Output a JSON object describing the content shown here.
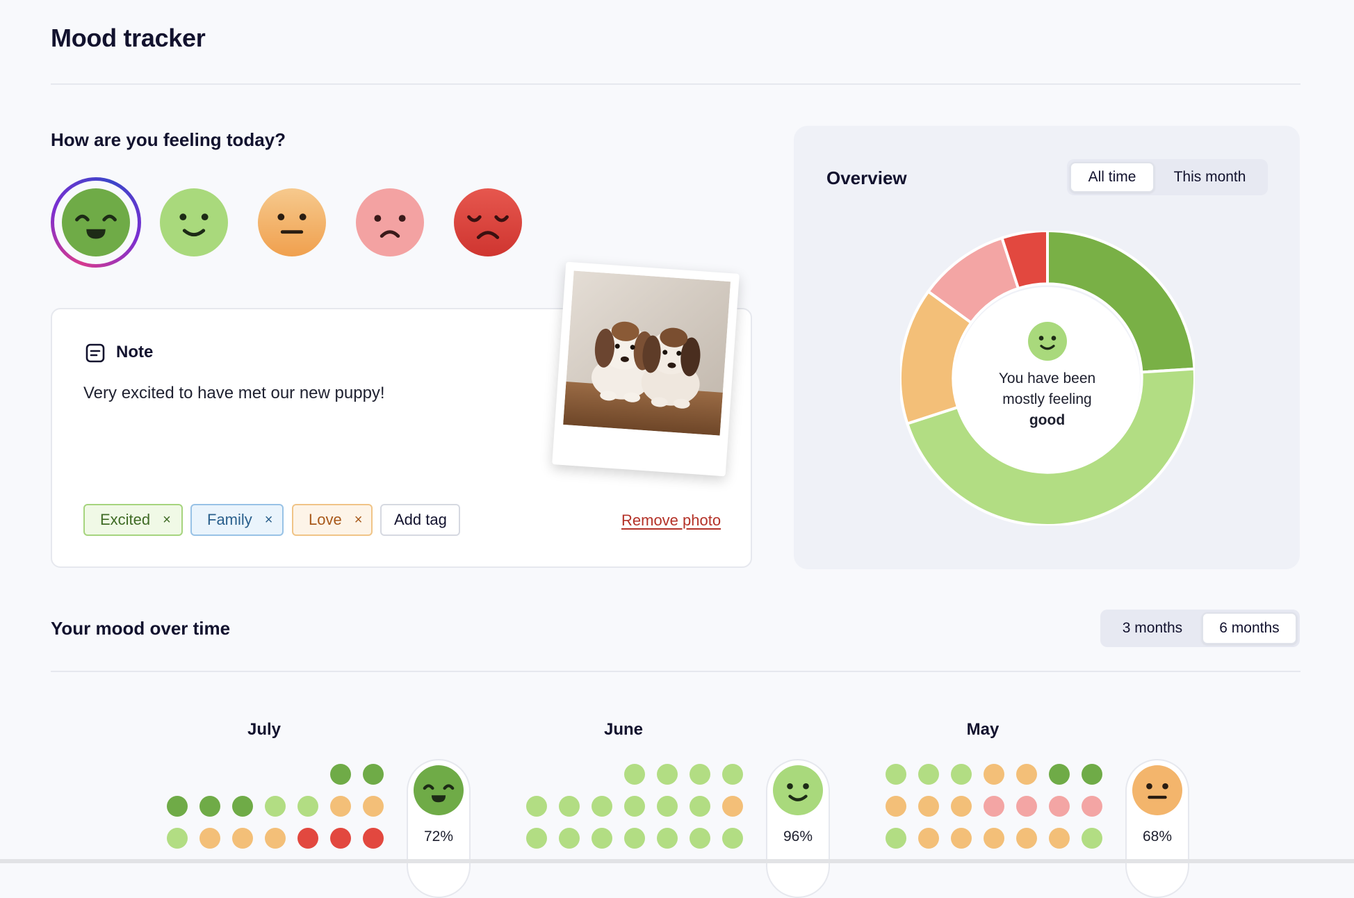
{
  "app": {
    "title": "Mood tracker"
  },
  "today": {
    "heading": "How are you feeling today?",
    "faces": [
      {
        "mood": "great",
        "color": "#6fab47",
        "icon": "very-happy-face-icon",
        "selected": true
      },
      {
        "mood": "good",
        "color": "#a9d97c",
        "icon": "happy-face-icon"
      },
      {
        "mood": "okay",
        "color": "#f3b56c",
        "icon": "neutral-face-icon"
      },
      {
        "mood": "sad",
        "color": "#f3a2a2",
        "icon": "sad-face-icon"
      },
      {
        "mood": "awful",
        "color": "#e24b43",
        "icon": "very-sad-face-icon"
      }
    ]
  },
  "note": {
    "title": "Note",
    "icon": "note-icon",
    "text": "Very excited to have met our new puppy!",
    "tags": [
      {
        "label": "Excited",
        "remove": "×",
        "bg": "#f0f9e6",
        "border": "#a6d47e",
        "color": "#3f6b25"
      },
      {
        "label": "Family",
        "remove": "×",
        "bg": "#eaf4fc",
        "border": "#98c2e6",
        "color": "#2a5f8c"
      },
      {
        "label": "Love",
        "remove": "×",
        "bg": "#fdf4e8",
        "border": "#f0c487",
        "color": "#a8591a"
      }
    ],
    "add_tag": "Add tag",
    "remove_photo": "Remove photo"
  },
  "overview": {
    "title": "Overview",
    "tabs": [
      "All time",
      "This month"
    ],
    "active_tab": "All time",
    "summary_line1": "You have been",
    "summary_line2": "mostly feeling",
    "summary_mood": "good"
  },
  "chart_data": {
    "type": "pie",
    "categories": [
      "great",
      "good",
      "okay",
      "sad",
      "awful"
    ],
    "values": [
      24,
      46,
      15,
      10,
      5
    ],
    "colors": [
      "#79b046",
      "#b2dd83",
      "#f3bf78",
      "#f3a5a4",
      "#e2483f"
    ],
    "hole": 0.64
  },
  "over_time": {
    "title": "Your mood over time",
    "tabs": [
      "3 months",
      "6 months"
    ],
    "active_tab": "6 months",
    "months": [
      {
        "name": "July",
        "percent": "72%",
        "face": "very-happy-face-icon",
        "face_color": "#6fab47",
        "rows": [
          [
            null,
            null,
            null,
            null,
            null,
            "#6fab47",
            "#6fab47"
          ],
          [
            "#6fab47",
            "#6fab47",
            "#6fab47",
            "#b2dd83",
            "#b2dd83",
            "#f3bf78",
            "#f3bf78"
          ],
          [
            "#b2dd83",
            "#f3bf78",
            "#f3bf78",
            "#f3bf78",
            "#e2483f",
            "#e2483f",
            "#e2483f"
          ]
        ]
      },
      {
        "name": "June",
        "percent": "96%",
        "face": "happy-face-icon",
        "face_color": "#a9d97c",
        "rows": [
          [
            null,
            null,
            null,
            "#b2dd83",
            "#b2dd83",
            "#b2dd83",
            "#b2dd83"
          ],
          [
            "#b2dd83",
            "#b2dd83",
            "#b2dd83",
            "#b2dd83",
            "#b2dd83",
            "#b2dd83",
            "#f3bf78"
          ],
          [
            "#b2dd83",
            "#b2dd83",
            "#b2dd83",
            "#b2dd83",
            "#b2dd83",
            "#b2dd83",
            "#b2dd83"
          ]
        ]
      },
      {
        "name": "May",
        "percent": "68%",
        "face": "neutral-face-icon",
        "face_color": "#f3b56c",
        "rows": [
          [
            "#b2dd83",
            "#b2dd83",
            "#b2dd83",
            "#f3bf78",
            "#f3bf78",
            "#6fab47",
            "#6fab47"
          ],
          [
            "#f3bf78",
            "#f3bf78",
            "#f3bf78",
            "#f3a5a4",
            "#f3a5a4",
            "#f3a5a4",
            "#f3a5a4"
          ],
          [
            "#b2dd83",
            "#f3bf78",
            "#f3bf78",
            "#f3bf78",
            "#f3bf78",
            "#f3bf78",
            "#b2dd83"
          ]
        ]
      }
    ]
  }
}
